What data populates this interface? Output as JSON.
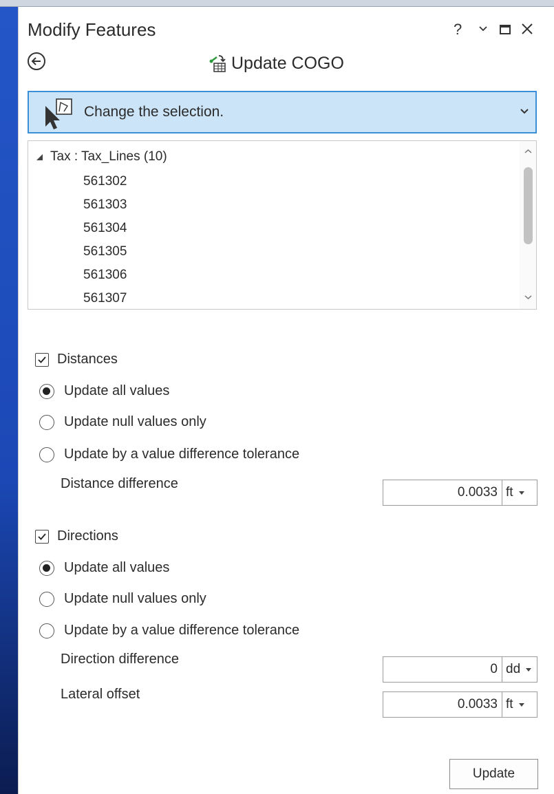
{
  "window": {
    "title": "Modify Features",
    "help": "?",
    "menu": "⌄",
    "maximize": "□",
    "close": "✕"
  },
  "tool": {
    "title": "Update COGO"
  },
  "selection": {
    "label": "Change the selection."
  },
  "tree": {
    "parent": "Tax : Tax_Lines (10)",
    "items": [
      "561302",
      "561303",
      "561304",
      "561305",
      "561306",
      "561307"
    ]
  },
  "distances": {
    "label": "Distances",
    "checked": true,
    "options": [
      "Update all values",
      "Update null values only",
      "Update by a value difference tolerance"
    ],
    "selected_index": 0,
    "difference_label": "Distance difference",
    "difference_value": "0.0033",
    "difference_unit": "ft"
  },
  "directions": {
    "label": "Directions",
    "checked": true,
    "options": [
      "Update all values",
      "Update null values only",
      "Update by a value difference tolerance"
    ],
    "selected_index": 0,
    "difference_label": "Direction difference",
    "difference_value": "0",
    "difference_unit": "dd",
    "offset_label": "Lateral offset",
    "offset_value": "0.0033",
    "offset_unit": "ft"
  },
  "update_button": "Update",
  "colors": {
    "background": "#1f4fc0",
    "selection_bar": "#cce4f7",
    "selection_border": "#3b8fd6"
  }
}
